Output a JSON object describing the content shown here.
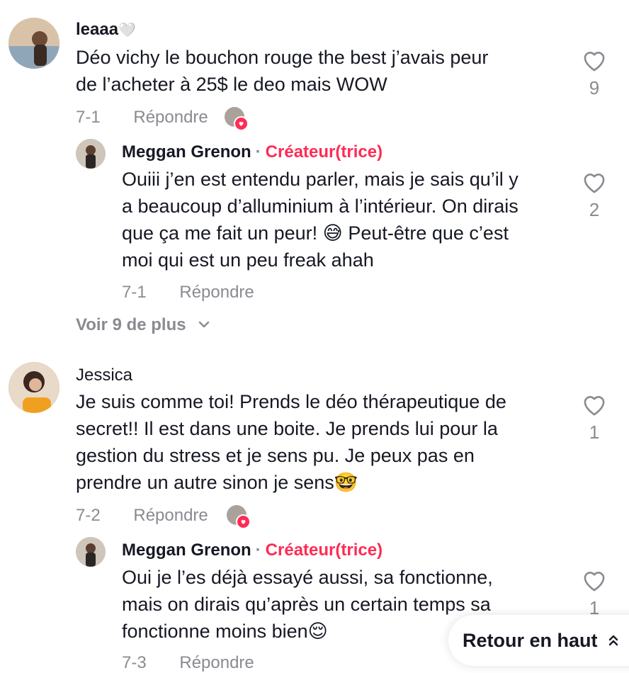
{
  "comments": [
    {
      "username": "leaaa",
      "username_suffix": "🤍",
      "text_lines": [
        "Déo vichy le bouchon rouge the best j’avais peur",
        "de l’acheter à 25$ le deo mais WOW"
      ],
      "date": "7-1",
      "reply_label": "Répondre",
      "likes": "9",
      "reply": {
        "username": "Meggan Grenon",
        "separator": "·",
        "creator_label": "Créateur(trice)",
        "text_lines": [
          "Ouiii j’en est entendu parler, mais je sais qu’il y",
          "a beaucoup d’alluminium à l’intérieur. On dirais",
          "que ça me fait un peur! 😅 Peut-être que c’est",
          "moi qui est un peu freak ahah"
        ],
        "date": "7-1",
        "reply_label": "Répondre",
        "likes": "2"
      },
      "view_more": "Voir 9 de plus"
    },
    {
      "username": "Jessica",
      "text_lines": [
        "Je suis comme toi! Prends le déo thérapeutique de",
        "secret!! Il est dans une boite. Je prends lui pour la",
        "gestion du stress et je sens pu. Je peux pas en",
        "prendre un autre sinon je sens🤓"
      ],
      "date": "7-2",
      "reply_label": "Répondre",
      "likes": "1",
      "reply": {
        "username": "Meggan Grenon",
        "separator": "·",
        "creator_label": "Créateur(trice)",
        "text_lines": [
          "Oui je l’es déjà essayé aussi, sa fonctionne,",
          "mais on dirais qu’après un certain temps sa",
          "fonctionne moins bien😌"
        ],
        "date": "7-3",
        "reply_label": "Répondre",
        "likes": "1"
      }
    }
  ],
  "back_to_top": "Retour en haut",
  "colors": {
    "accent": "#fe2c55",
    "muted": "#8a8b91",
    "text": "#161823"
  },
  "icons": [
    "heart-outline-icon",
    "chevron-down-icon",
    "double-chevron-up-icon",
    "heart-badge-icon"
  ]
}
